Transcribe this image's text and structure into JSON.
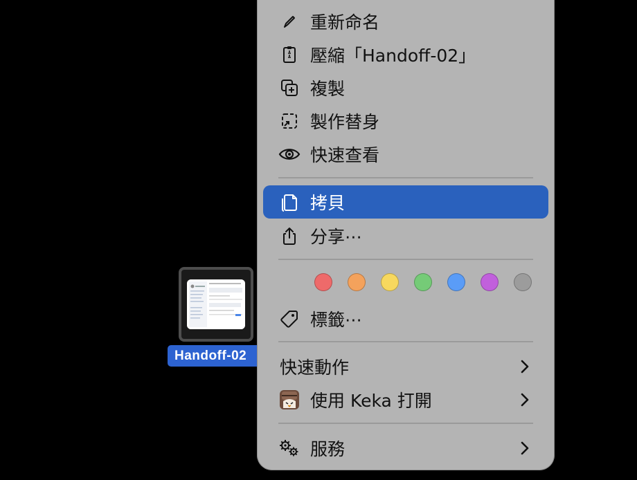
{
  "desktop_file": {
    "name": "Handoff-02",
    "icon": "document-thumbnail-icon"
  },
  "menu": {
    "items": [
      {
        "id": "rename",
        "label": "重新命名",
        "icon": "pencil-icon"
      },
      {
        "id": "compress",
        "label": "壓縮「Handoff-02」",
        "icon": "zip-archive-icon"
      },
      {
        "id": "duplicate",
        "label": "複製",
        "icon": "duplicate-icon"
      },
      {
        "id": "alias",
        "label": "製作替身",
        "icon": "alias-icon"
      },
      {
        "id": "quicklook",
        "label": "快速查看",
        "icon": "eye-icon"
      },
      {
        "id": "copy",
        "label": "拷貝",
        "icon": "copy-document-icon",
        "highlighted": true
      },
      {
        "id": "share",
        "label": "分享⋯",
        "icon": "share-icon"
      },
      {
        "id": "tags",
        "label": "標籤⋯",
        "icon": "tag-icon"
      },
      {
        "id": "quick_actions",
        "label": "快速動作",
        "submenu": true
      },
      {
        "id": "open_keka",
        "label": "使用 Keka 打開",
        "icon": "keka-app-icon",
        "submenu": true
      },
      {
        "id": "services",
        "label": "服務",
        "icon": "gears-icon",
        "submenu": true
      }
    ],
    "tag_colors": [
      {
        "name": "red",
        "color": "#ee6a6a"
      },
      {
        "name": "orange",
        "color": "#f4a25c"
      },
      {
        "name": "yellow",
        "color": "#f7d85e"
      },
      {
        "name": "green",
        "color": "#75cb77"
      },
      {
        "name": "blue",
        "color": "#5a9cf7"
      },
      {
        "name": "purple",
        "color": "#c160dc"
      },
      {
        "name": "gray",
        "color": "#9c9c9c"
      }
    ],
    "highlight_color": "#2a61bd"
  }
}
